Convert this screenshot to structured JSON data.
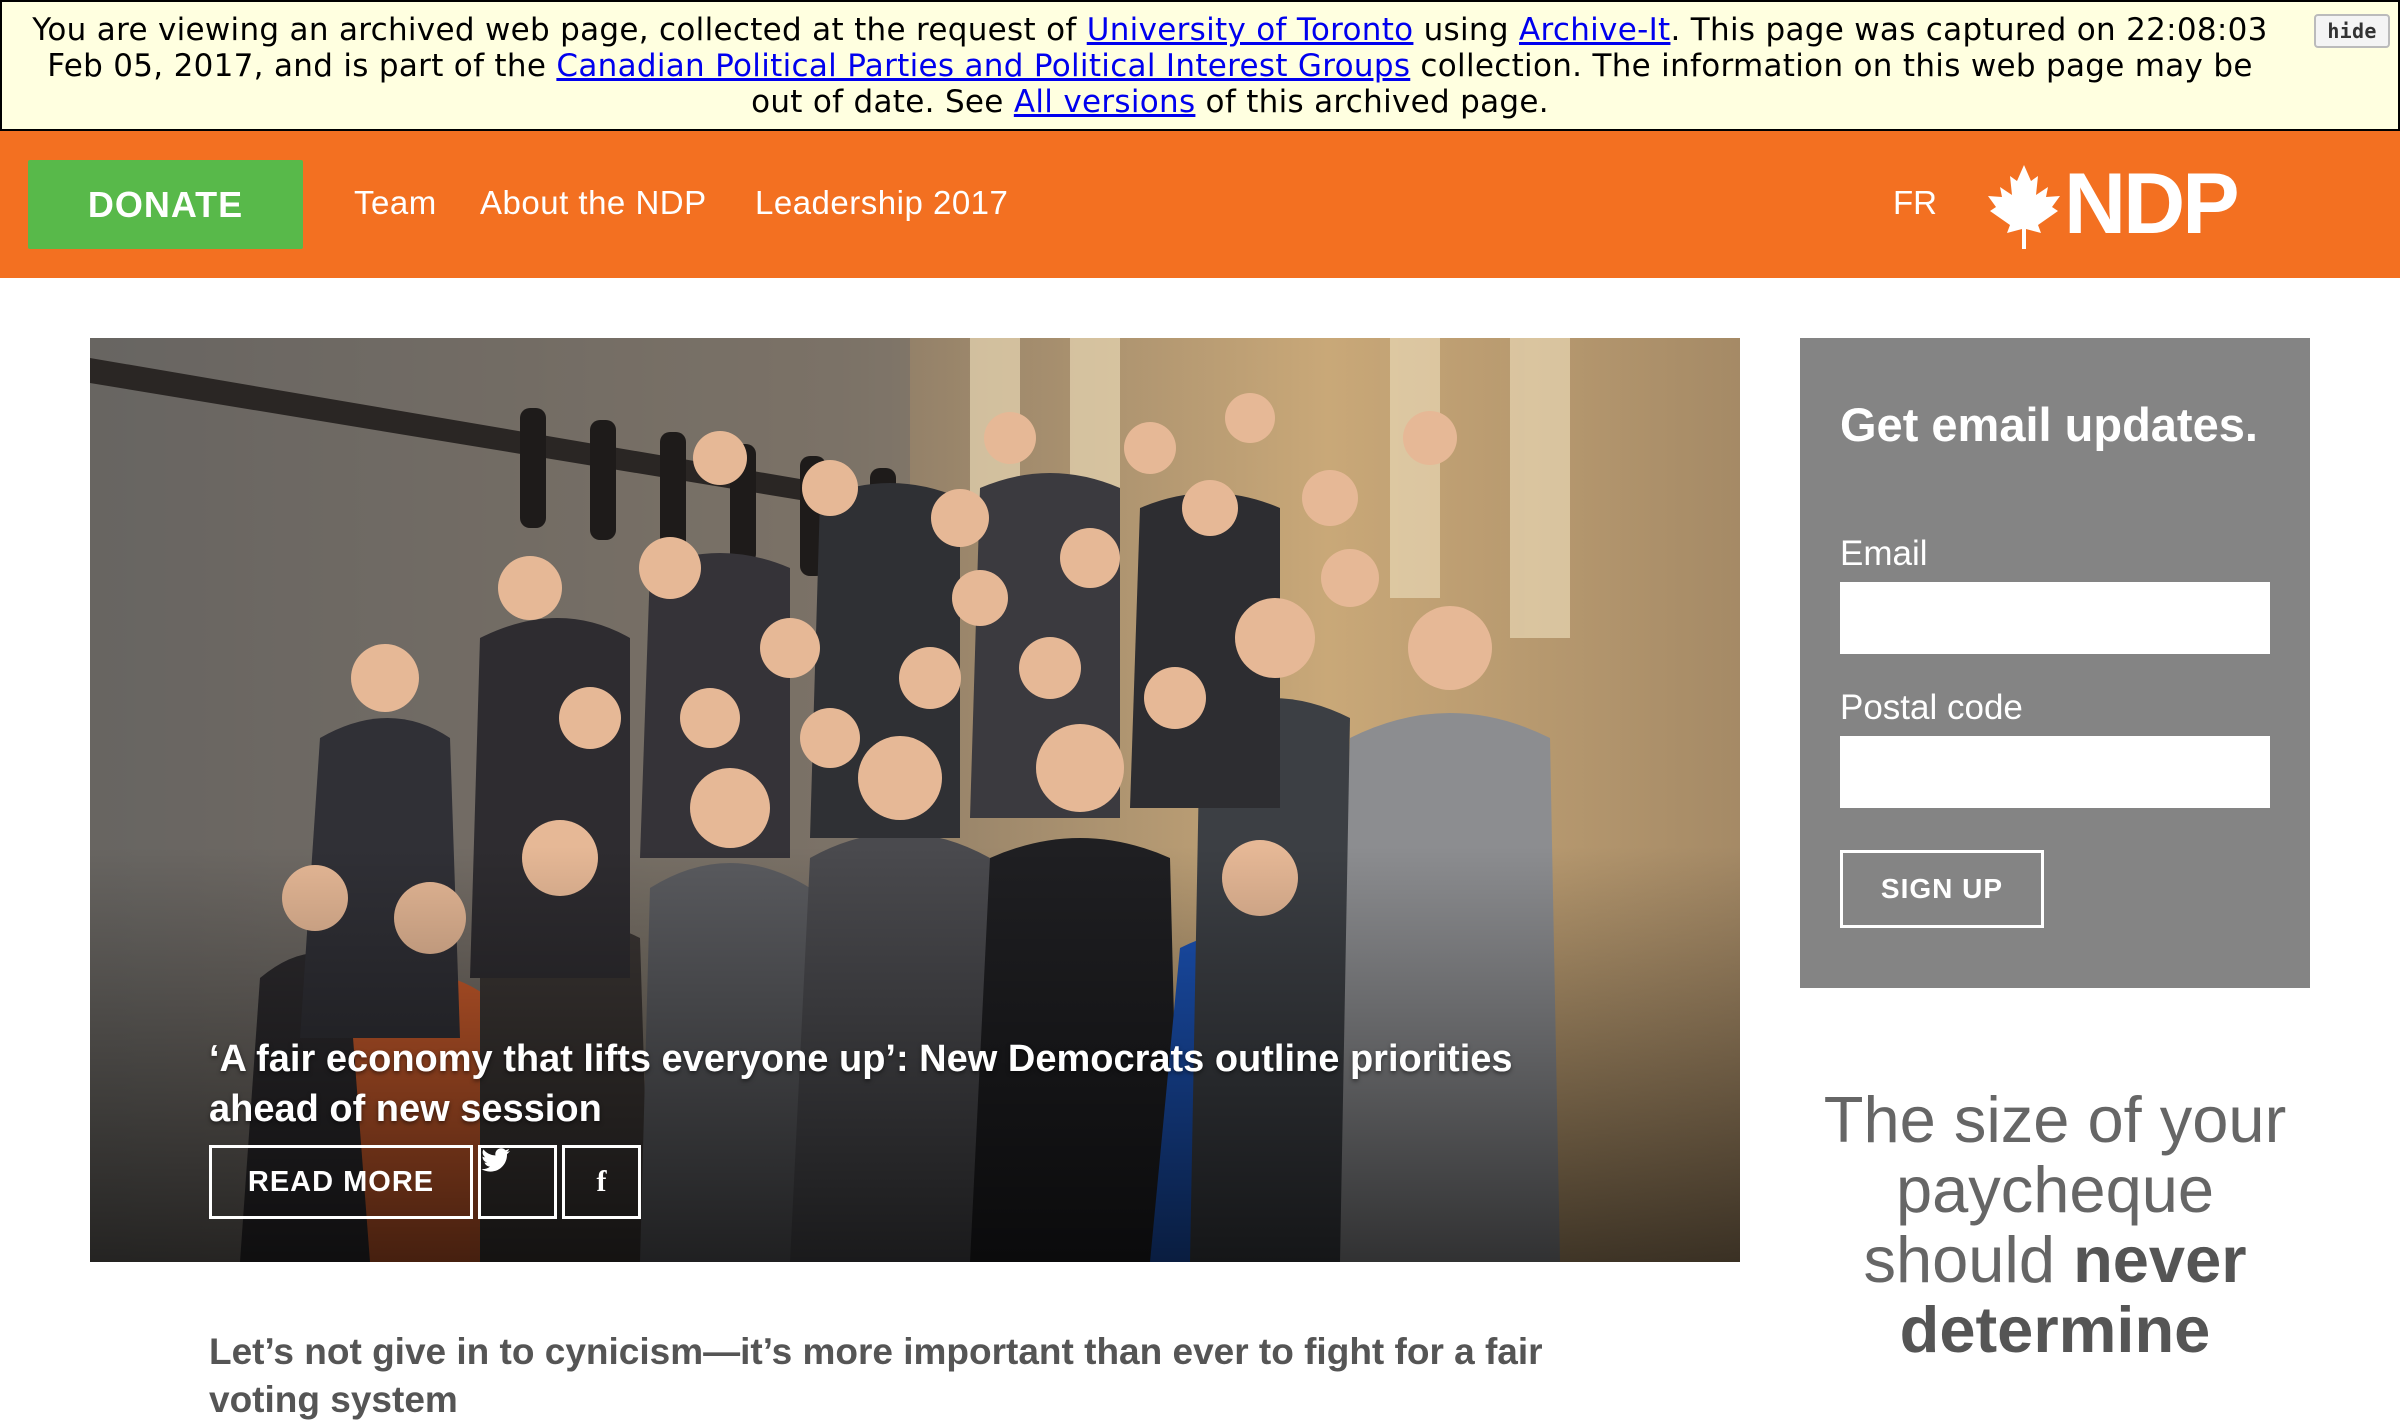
{
  "archive_banner": {
    "text_1": "You are viewing an archived web page, collected at the request of ",
    "link_1": "University of Toronto",
    "text_2": " using ",
    "link_2": "Archive-It",
    "text_3": ". This page was captured on 22:08:03 Feb 05, 2017, and is part of the ",
    "link_3": "Canadian Political Parties and Political Interest Groups",
    "text_4": " collection. The information on this web page may be out of date. See ",
    "link_4": "All versions",
    "text_5": " of this archived page.",
    "hide_label": "hide"
  },
  "header": {
    "donate_label": "DONATE",
    "nav": [
      "Team",
      "About the NDP",
      "Leadership 2017"
    ],
    "lang_label": "FR",
    "logo_text": "NDP",
    "logo_icon": "maple-leaf-icon"
  },
  "hero": {
    "title": "‘A fair economy that lifts everyone up’: New Democrats outline priorities ahead of new session",
    "read_more_label": "READ MORE",
    "twitter_glyph": "🐦",
    "facebook_glyph": "f"
  },
  "article": {
    "headline": "Let’s not give in to cynicism—it’s more important than ever to fight for a fair voting system"
  },
  "email_signup": {
    "title": "Get email updates.",
    "email_label": "Email",
    "email_value": "",
    "postal_label": "Postal code",
    "postal_value": "",
    "signup_label": "SIGN UP"
  },
  "tagline": {
    "text_plain": "The size of your paycheque should ",
    "text_bold": "never determine"
  },
  "colors": {
    "header_bg": "#f37021",
    "donate_bg": "#58b94a",
    "banner_bg": "#ffffe0",
    "panel_bg": "#848484"
  }
}
